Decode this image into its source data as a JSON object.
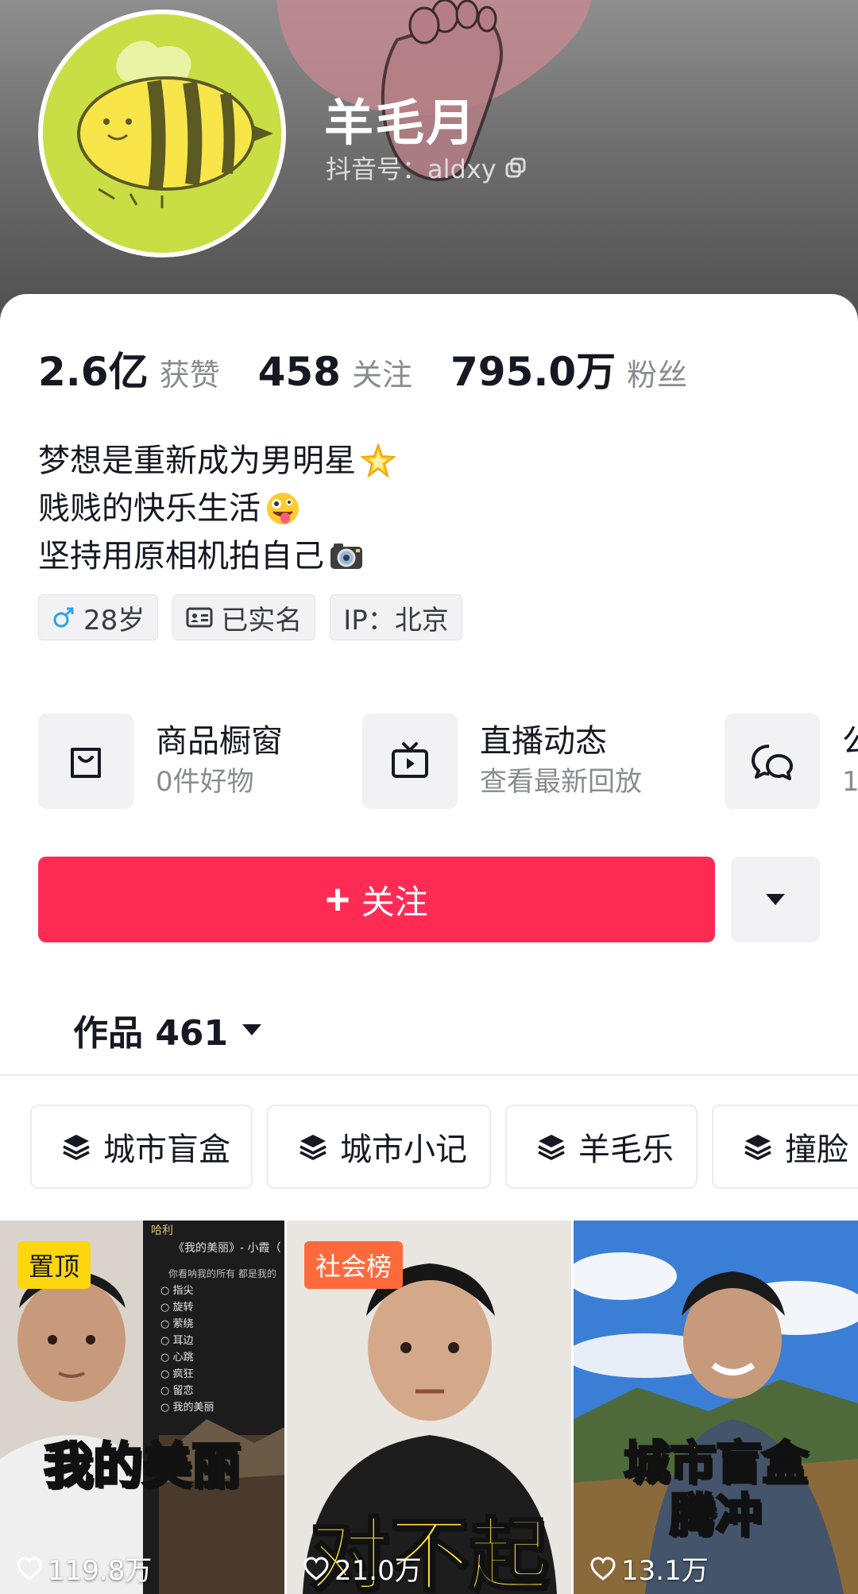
{
  "profile": {
    "name": "羊毛月",
    "douyin_id": "抖音号：aldxy"
  },
  "stats": [
    {
      "value": "2.6亿",
      "label": "获赞"
    },
    {
      "value": "458",
      "label": "关注"
    },
    {
      "value": "795.0万",
      "label": "粉丝"
    }
  ],
  "bio": [
    {
      "text": "梦想是重新成为男明星",
      "emoji": "star-emoji"
    },
    {
      "text": "贱贱的快乐生活",
      "emoji": "zany-face-emoji"
    },
    {
      "text": "坚持用原相机拍自己",
      "emoji": "camera-emoji"
    }
  ],
  "tags": [
    {
      "text": "28岁",
      "icon": "male-icon"
    },
    {
      "text": "已实名",
      "icon": "id-card-icon"
    },
    {
      "text": "IP：北京",
      "icon": ""
    }
  ],
  "services": [
    {
      "title": "商品橱窗",
      "subtitle": "0件好物",
      "icon": "shopping-bag-icon"
    },
    {
      "title": "直播动态",
      "subtitle": "查看最新回放",
      "icon": "tv-icon"
    },
    {
      "title": "公",
      "subtitle": "1",
      "icon": "chat-bubbles-icon"
    }
  ],
  "follow_button": {
    "label": "关注",
    "color": "#fe2c55"
  },
  "works_tab": {
    "label": "作品 461"
  },
  "collections": [
    "城市盲盒",
    "城市小记",
    "羊毛乐",
    "撞脸"
  ],
  "videos": [
    {
      "badge": "置顶",
      "badge_color": "#fcd60f",
      "caption": "我的美丽",
      "likes": "119.8万",
      "overlay_title": "《我的美丽》- 小霞（",
      "overlay_sub": "你看呐我的所有 都是我的",
      "overlay_back": "哈利",
      "overlay_items": [
        "指尖",
        "旋转",
        "萦绕",
        "耳边",
        "心跳",
        "疯狂",
        "留恋",
        "我的美丽"
      ]
    },
    {
      "badge": "社会榜",
      "badge_color": "#ff6a3d",
      "caption": "对不起",
      "likes": "21.0万"
    },
    {
      "badge": "",
      "badge_color": "",
      "caption": "城市盲盒\n腾冲",
      "caption_line1": "城市盲盒",
      "caption_line2": "腾冲",
      "likes": "13.1万"
    }
  ]
}
